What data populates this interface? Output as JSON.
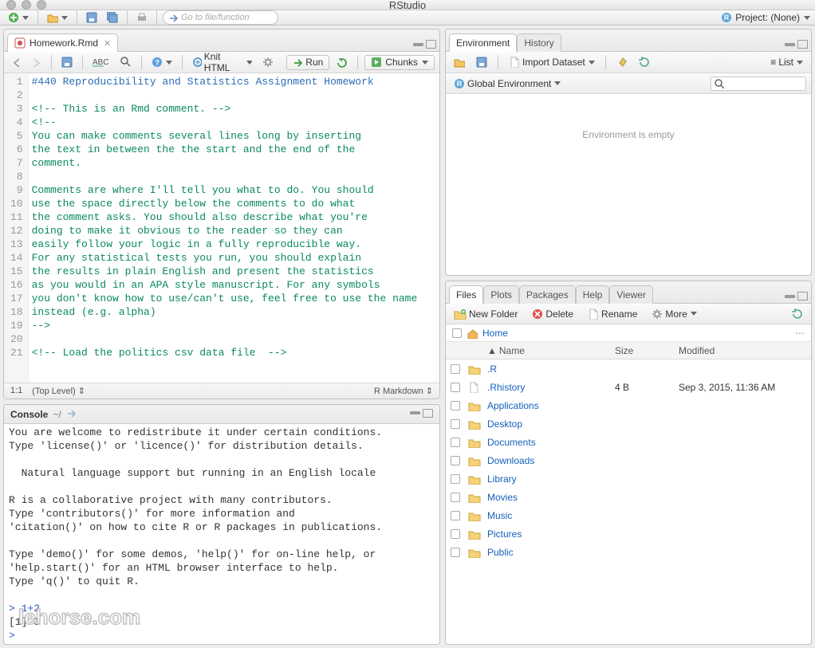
{
  "window": {
    "title": "RStudio"
  },
  "project": {
    "label": "Project: (None)"
  },
  "mainToolbar": {
    "gotoPlaceholder": "Go to file/function"
  },
  "source": {
    "tab": {
      "filename": "Homework.Rmd"
    },
    "toolbar": {
      "knit": "Knit HTML",
      "run": "Run",
      "chunks": "Chunks"
    },
    "lines": [
      {
        "n": 1,
        "text": "#440 Reproducibility and Statistics Assignment Homework",
        "cls": "hl-heading"
      },
      {
        "n": 2,
        "text": "",
        "cls": ""
      },
      {
        "n": 3,
        "text": "<!-- This is an Rmd comment. -->",
        "cls": "hl-comment"
      },
      {
        "n": 4,
        "text": "<!--",
        "cls": "hl-comment"
      },
      {
        "n": 5,
        "text": "You can make comments several lines long by inserting",
        "cls": "hl-comment"
      },
      {
        "n": 6,
        "text": "the text in between the the start and the end of the",
        "cls": "hl-comment"
      },
      {
        "n": 7,
        "text": "comment.",
        "cls": "hl-comment"
      },
      {
        "n": 8,
        "text": "",
        "cls": "hl-comment"
      },
      {
        "n": 9,
        "text": "Comments are where I'll tell you what to do. You should",
        "cls": "hl-comment"
      },
      {
        "n": 10,
        "text": "use the space directly below the comments to do what",
        "cls": "hl-comment"
      },
      {
        "n": 11,
        "text": "the comment asks. You should also describe what you're",
        "cls": "hl-comment"
      },
      {
        "n": 12,
        "text": "doing to make it obvious to the reader so they can",
        "cls": "hl-comment"
      },
      {
        "n": 13,
        "text": "easily follow your logic in a fully reproducible way.",
        "cls": "hl-comment"
      },
      {
        "n": 14,
        "text": "For any statistical tests you run, you should explain",
        "cls": "hl-comment"
      },
      {
        "n": 15,
        "text": "the results in plain English and present the statistics",
        "cls": "hl-comment"
      },
      {
        "n": 16,
        "text": "as you would in an APA style manuscript. For any symbols",
        "cls": "hl-comment"
      },
      {
        "n": 17,
        "text": "you don't know how to use/can't use, feel free to use the name",
        "cls": "hl-comment"
      },
      {
        "n": 18,
        "text": "instead (e.g. alpha)",
        "cls": "hl-comment"
      },
      {
        "n": 19,
        "text": "-->",
        "cls": "hl-comment"
      },
      {
        "n": 20,
        "text": "",
        "cls": ""
      },
      {
        "n": 21,
        "text": "<!-- Load the politics csv data file  -->",
        "cls": "hl-comment"
      }
    ],
    "status": {
      "pos": "1:1",
      "scope": "(Top Level) ",
      "lang": "R Markdown "
    }
  },
  "console": {
    "title": "Console",
    "cwd": "~/",
    "body": "You are welcome to redistribute it under certain conditions.\nType 'license()' or 'licence()' for distribution details.\n\n  Natural language support but running in an English locale\n\nR is a collaborative project with many contributors.\nType 'contributors()' for more information and\n'citation()' on how to cite R or R packages in publications.\n\nType 'demo()' for some demos, 'help()' for on-line help, or\n'help.start()' for an HTML browser interface to help.\nType 'q()' to quit R.\n",
    "input1_prompt": "> ",
    "input1_text": "1+2",
    "output1": "[1] 3",
    "input2_prompt": "> ",
    "input2_text": ""
  },
  "env": {
    "tabs": {
      "environment": "Environment",
      "history": "History"
    },
    "toolbar": {
      "import": "Import Dataset",
      "list": "List"
    },
    "scope": "Global Environment",
    "empty": "Environment is empty"
  },
  "files": {
    "tabs": {
      "files": "Files",
      "plots": "Plots",
      "packages": "Packages",
      "help": "Help",
      "viewer": "Viewer"
    },
    "toolbar": {
      "newFolder": "New Folder",
      "delete": "Delete",
      "rename": "Rename",
      "more": "More"
    },
    "breadcrumb": "Home",
    "columns": {
      "name": "Name",
      "size": "Size",
      "modified": "Modified"
    },
    "rows": [
      {
        "name": ".R",
        "icon": "folder",
        "size": "",
        "modified": ""
      },
      {
        "name": ".Rhistory",
        "icon": "file",
        "size": "4 B",
        "modified": "Sep 3, 2015, 11:36 AM"
      },
      {
        "name": "Applications",
        "icon": "folder",
        "size": "",
        "modified": ""
      },
      {
        "name": "Desktop",
        "icon": "folder",
        "size": "",
        "modified": ""
      },
      {
        "name": "Documents",
        "icon": "folder",
        "size": "",
        "modified": ""
      },
      {
        "name": "Downloads",
        "icon": "folder",
        "size": "",
        "modified": ""
      },
      {
        "name": "Library",
        "icon": "folder",
        "size": "",
        "modified": ""
      },
      {
        "name": "Movies",
        "icon": "folder",
        "size": "",
        "modified": ""
      },
      {
        "name": "Music",
        "icon": "folder",
        "size": "",
        "modified": ""
      },
      {
        "name": "Pictures",
        "icon": "folder",
        "size": "",
        "modified": ""
      },
      {
        "name": "Public",
        "icon": "folder",
        "size": "",
        "modified": ""
      }
    ]
  },
  "watermark": "lehorse.com"
}
